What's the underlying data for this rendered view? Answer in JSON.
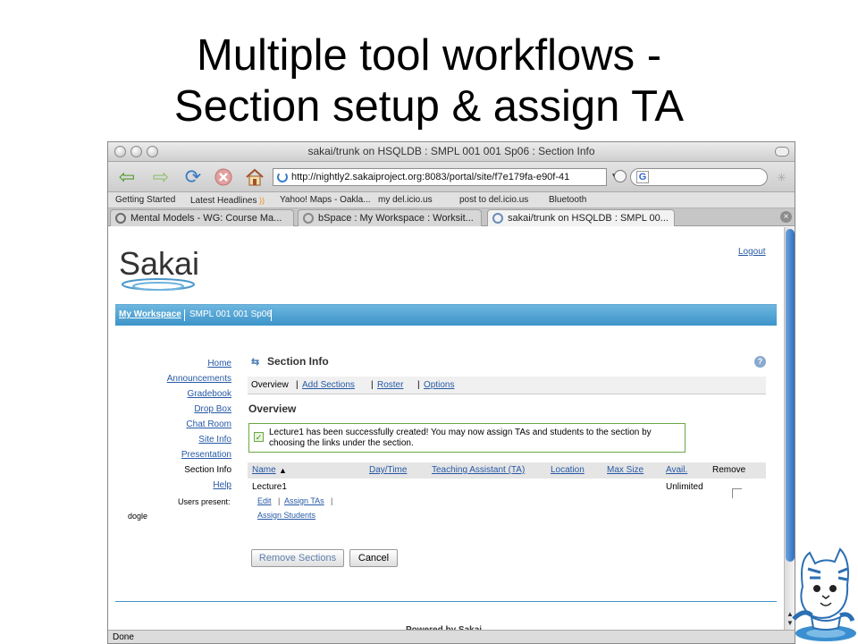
{
  "slide": {
    "title_line1": "Multiple tool workflows -",
    "title_line2": "Section setup & assign TA"
  },
  "window": {
    "title": "sakai/trunk on HSQLDB : SMPL 001 001 Sp06 : Section Info"
  },
  "toolbar": {
    "url": "http://nightly2.sakaiproject.org:8083/portal/site/f7e179fa-e90f-41",
    "search_value": ""
  },
  "bookmarks": [
    "Getting Started",
    "Latest Headlines",
    "Yahoo! Maps - Oakla...",
    "my del.icio.us",
    "post to del.icio.us",
    "Bluetooth"
  ],
  "tabs": [
    {
      "label": "Mental Models - WG: Course Ma..."
    },
    {
      "label": "bSpace : My Workspace : Worksit..."
    },
    {
      "label": "sakai/trunk on HSQLDB : SMPL 00..."
    }
  ],
  "page": {
    "logo": "Sakai",
    "logout": "Logout",
    "site_tabs": [
      "My Workspace",
      "SMPL 001 001 Sp06"
    ],
    "tool_menu": [
      "Home",
      "Announcements",
      "Gradebook",
      "Drop Box",
      "Chat Room",
      "Site Info",
      "Presentation",
      "Section Info",
      "Help"
    ],
    "presence_label": "Users present:",
    "presence_user": "dogle",
    "tool_title": "Section Info",
    "tool_nav": {
      "overview": "Overview",
      "sep1": "|",
      "add_sections": "Add Sections",
      "sep2": "|",
      "roster": "Roster",
      "sep3": "|",
      "options": "Options"
    },
    "section_heading": "Overview",
    "success_message": "Lecture1 has been successfully created! You may now assign TAs and students to the section by choosing the links under the section.",
    "table": {
      "headers": [
        "Name",
        "Day/Time",
        "Teaching Assistant (TA)",
        "Location",
        "Max Size",
        "Avail.",
        "Remove"
      ],
      "rows": [
        {
          "name": "Lecture1",
          "avail": "Unlimited",
          "actions": [
            "Edit",
            "Assign TAs",
            "Assign Students"
          ],
          "sep": "|"
        }
      ]
    },
    "buttons": {
      "remove": "Remove Sections",
      "cancel": "Cancel"
    },
    "footer_sep": "|",
    "powered_by": "Powered by Sakai"
  },
  "status": "Done",
  "colors": {
    "sakai_blue": "#3c94c9",
    "link": "#2659a6",
    "success_border": "#6aa842"
  }
}
